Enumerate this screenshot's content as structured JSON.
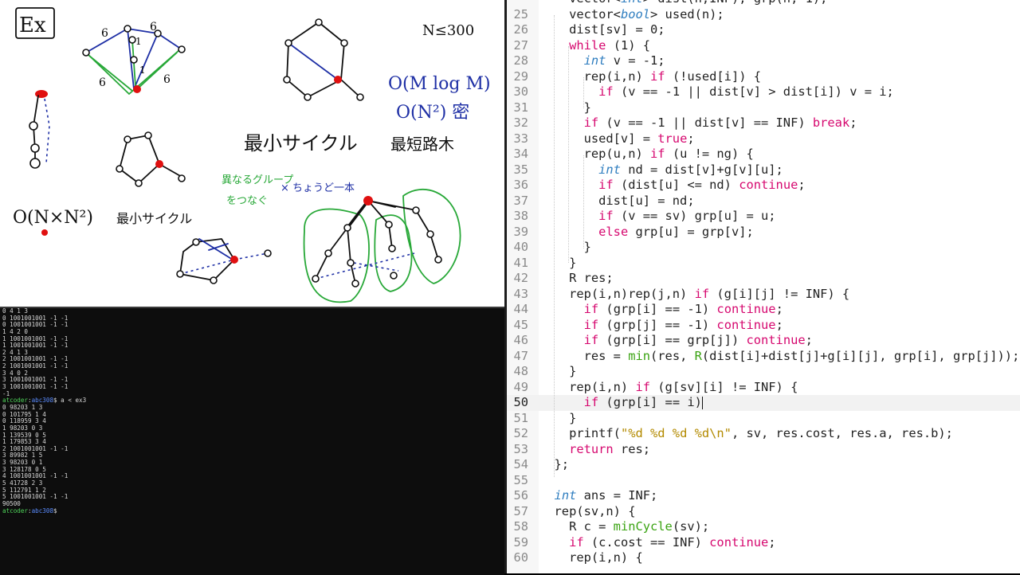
{
  "whiteboard": {
    "ex_label": "Ex",
    "constraint": "N≤300",
    "complexity_1": "O(M log M)",
    "complexity_2": "O(N²) 密",
    "complexity_left": "O(N×N²)",
    "min_cycle_big": "最小サイクル",
    "min_cycle_small": "最小サイクル",
    "shortest_path_tree": "最短路木",
    "green_note_1": "異なるグループ",
    "green_note_2": "をつなぐ",
    "blue_note": "× ちょうど一本",
    "edge_weights": [
      "6",
      "6",
      "6",
      "6",
      "1",
      "1"
    ]
  },
  "terminal": {
    "prompt_user": "atcoder",
    "prompt_path": "abc308",
    "lines_before": [
      "0 4 1 3",
      "0 1001001001 -1 -1",
      "0 1001001001 -1 -1",
      "1 4 2 0",
      "1 1001001001 -1 -1",
      "1 1001001001 -1 -1",
      "2 4 1 3",
      "2 1001001001 -1 -1",
      "2 1001001001 -1 -1",
      "3 4 0 2",
      "3 1001001001 -1 -1",
      "3 1001001001 -1 -1",
      "-1"
    ],
    "command": "$ a < ex3",
    "lines_after": [
      "0 98203 1 3",
      "0 101795 1 4",
      "0 118959 3 4",
      "1 98203 0 3",
      "1 139539 0 5",
      "1 179853 3 4",
      "2 1001001001 -1 -1",
      "3 89982 1 5",
      "3 98203 0 1",
      "3 128178 0 5",
      "4 1001001001 -1 -1",
      "5 41728 2 3",
      "5 112791 1 2",
      "5 1001001001 -1 -1",
      "90500"
    ],
    "final_prompt": "$"
  },
  "editor": {
    "current_line": "50",
    "lines": [
      {
        "n": "",
        "code": "    vector<int> dist(n,INF); grp(n,-1);"
      },
      {
        "n": "25",
        "code": "    vector<bool> used(n);"
      },
      {
        "n": "26",
        "code": "    dist[sv] = 0;"
      },
      {
        "n": "27",
        "code": "    while (1) {"
      },
      {
        "n": "28",
        "code": "      int v = -1;"
      },
      {
        "n": "29",
        "code": "      rep(i,n) if (!used[i]) {"
      },
      {
        "n": "30",
        "code": "        if (v == -1 || dist[v] > dist[i]) v = i;"
      },
      {
        "n": "31",
        "code": "      }"
      },
      {
        "n": "32",
        "code": "      if (v == -1 || dist[v] == INF) break;"
      },
      {
        "n": "33",
        "code": "      used[v] = true;"
      },
      {
        "n": "34",
        "code": "      rep(u,n) if (u != ng) {"
      },
      {
        "n": "35",
        "code": "        int nd = dist[v]+g[v][u];"
      },
      {
        "n": "36",
        "code": "        if (dist[u] <= nd) continue;"
      },
      {
        "n": "37",
        "code": "        dist[u] = nd;"
      },
      {
        "n": "38",
        "code": "        if (v == sv) grp[u] = u;"
      },
      {
        "n": "39",
        "code": "        else grp[u] = grp[v];"
      },
      {
        "n": "40",
        "code": "      }"
      },
      {
        "n": "41",
        "code": "    }"
      },
      {
        "n": "42",
        "code": "    R res;"
      },
      {
        "n": "43",
        "code": "    rep(i,n)rep(j,n) if (g[i][j] != INF) {"
      },
      {
        "n": "44",
        "code": "      if (grp[i] == -1) continue;"
      },
      {
        "n": "45",
        "code": "      if (grp[j] == -1) continue;"
      },
      {
        "n": "46",
        "code": "      if (grp[i] == grp[j]) continue;"
      },
      {
        "n": "47",
        "code": "      res = min(res, R(dist[i]+dist[j]+g[i][j], grp[i], grp[j]));"
      },
      {
        "n": "48",
        "code": "    }"
      },
      {
        "n": "49",
        "code": "    rep(i,n) if (g[sv][i] != INF) {"
      },
      {
        "n": "50",
        "code": "      if (grp[i] == i)"
      },
      {
        "n": "51",
        "code": "    }"
      },
      {
        "n": "52",
        "code": "    printf(\"%d %d %d %d\\n\", sv, res.cost, res.a, res.b);"
      },
      {
        "n": "53",
        "code": "    return res;"
      },
      {
        "n": "54",
        "code": "  };"
      },
      {
        "n": "55",
        "code": ""
      },
      {
        "n": "56",
        "code": "  int ans = INF;"
      },
      {
        "n": "57",
        "code": "  rep(sv,n) {"
      },
      {
        "n": "58",
        "code": "    R c = minCycle(sv);"
      },
      {
        "n": "59",
        "code": "    if (c.cost == INF) continue;"
      },
      {
        "n": "60",
        "code": "    rep(i,n) {"
      }
    ]
  },
  "colors": {
    "keyword": "#d6086f",
    "type": "#2e7dbf",
    "function": "#3aa312",
    "string": "#b38a00",
    "ink_black": "#101010",
    "ink_blue": "#1e2fa5",
    "ink_green": "#28a838",
    "ink_red": "#e01010"
  }
}
